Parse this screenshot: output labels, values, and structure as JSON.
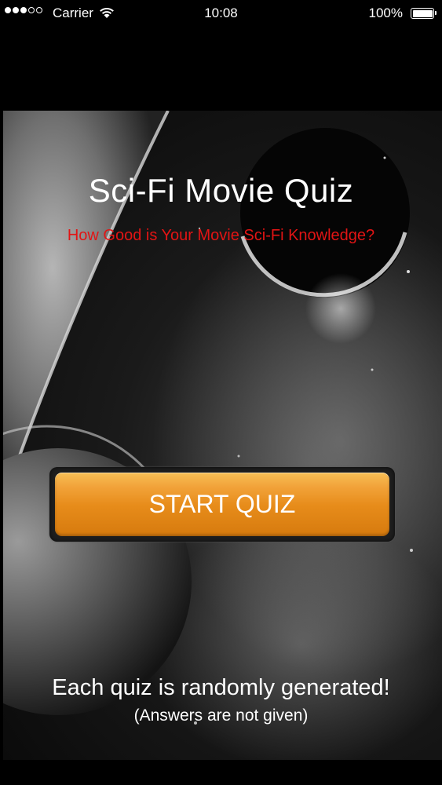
{
  "status_bar": {
    "carrier": "Carrier",
    "time": "10:08",
    "battery": "100%",
    "battery_level": 1.0,
    "signal_bars_filled": 3,
    "signal_bars_total": 5
  },
  "title": "Sci-Fi Movie Quiz",
  "subtitle": "How Good is Your Movie Sci-Fi Knowledge?",
  "start_button_label": "START QUIZ",
  "info": {
    "main": "Each quiz is randomly generated!",
    "sub": "(Answers are not given)"
  },
  "colors": {
    "subtitle": "#e21414",
    "button": "#e78c1a",
    "background": "#000000"
  },
  "icons": {
    "wifi": "wifi-icon",
    "battery": "battery-icon",
    "signal": "signal-dots-icon"
  }
}
